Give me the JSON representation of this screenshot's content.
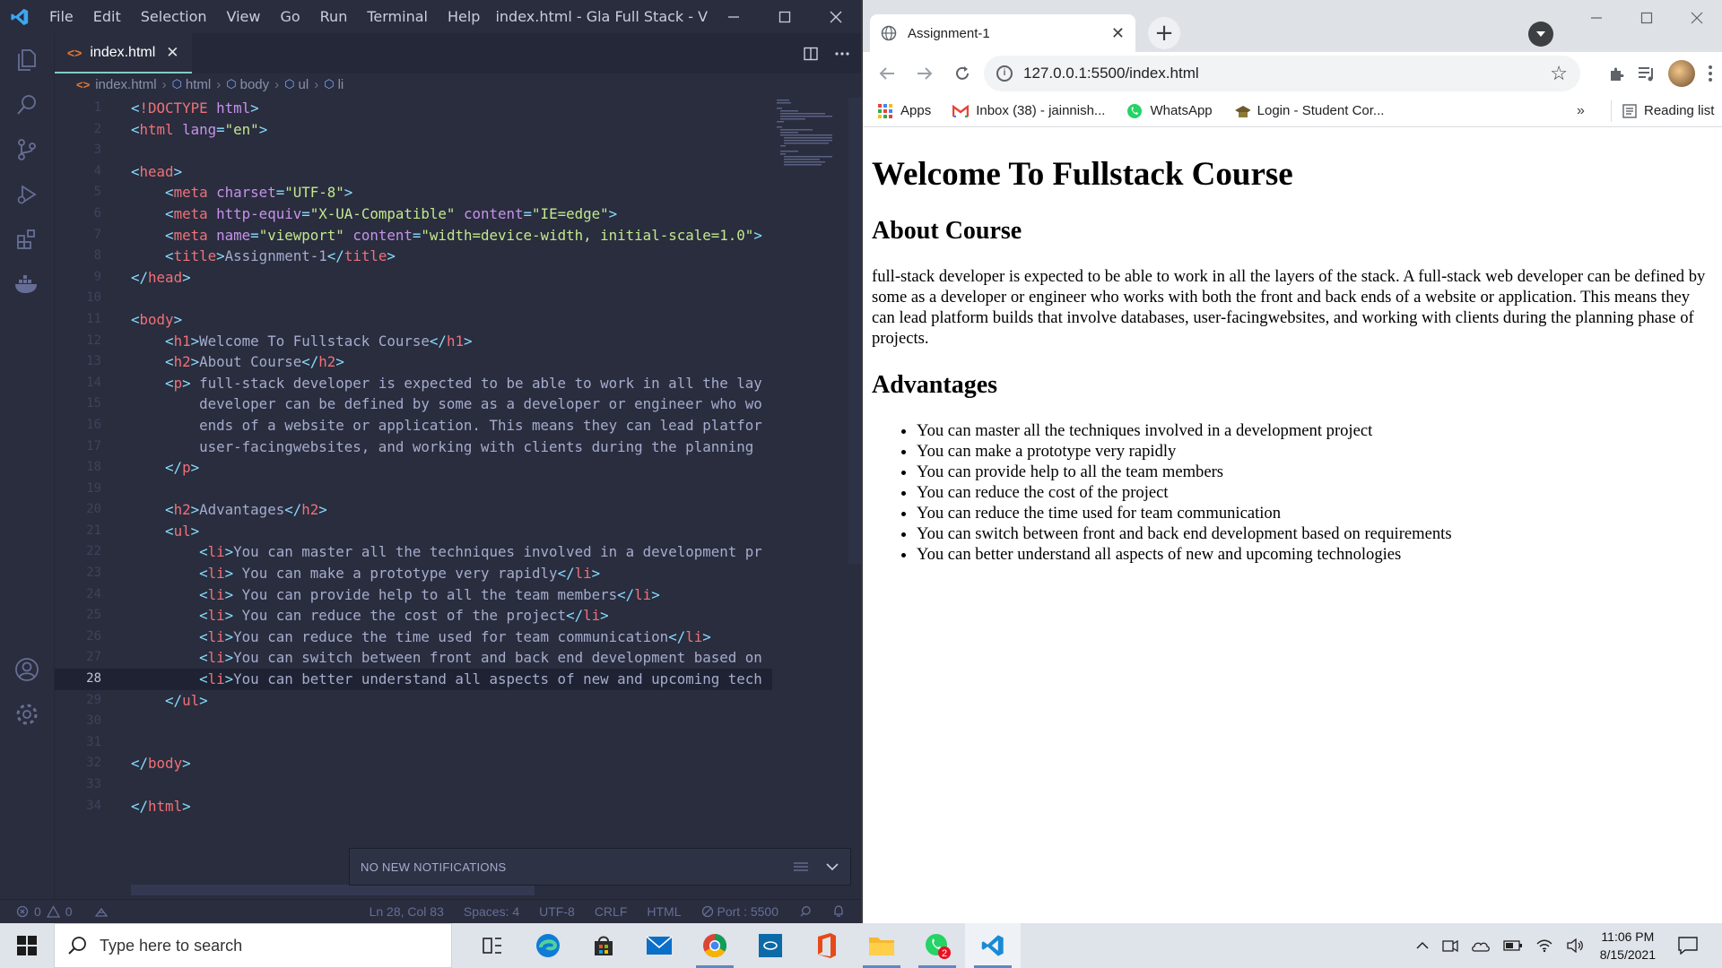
{
  "vscode": {
    "window_title": "index.html - Gla Full Stack - Visual Studio...",
    "menu": [
      "File",
      "Edit",
      "Selection",
      "View",
      "Go",
      "Run",
      "Terminal",
      "Help"
    ],
    "tab": {
      "label": "index.html",
      "close": "✕"
    },
    "breadcrumb": [
      "index.html",
      "html",
      "body",
      "ul",
      "li"
    ],
    "code_lines": [
      "<!DOCTYPE html>",
      "<html lang=\"en\">",
      "",
      "<head>",
      "    <meta charset=\"UTF-8\">",
      "    <meta http-equiv=\"X-UA-Compatible\" content=\"IE=edge\">",
      "    <meta name=\"viewport\" content=\"width=device-width, initial-scale=1.0\">",
      "    <title>Assignment-1</title>",
      "</head>",
      "",
      "<body>",
      "    <h1>Welcome To Fullstack Course</h1>",
      "    <h2>About Course</h2>",
      "    <p> full-stack developer is expected to be able to work in all the lay",
      "        developer can be defined by some as a developer or engineer who wo",
      "        ends of a website or application. This means they can lead platfor",
      "        user-facingwebsites, and working with clients during the planning ",
      "    </p>",
      "",
      "    <h2>Advantages</h2>",
      "    <ul>",
      "        <li>You can master all the techniques involved in a development pr",
      "        <li> You can make a prototype very rapidly</li>",
      "        <li> You can provide help to all the team members</li>",
      "        <li> You can reduce the cost of the project</li>",
      "        <li>You can reduce the time used for team communication</li>",
      "        <li>You can switch between front and back end development based on",
      "        <li>You can better understand all aspects of new and upcoming tech",
      "    </ul>",
      "",
      "",
      "</body>",
      "",
      "</html>"
    ],
    "active_line": 28,
    "notification": "NO NEW NOTIFICATIONS",
    "status": {
      "errors": "0",
      "warnings": "0",
      "position": "Ln 28, Col 83",
      "spaces": "Spaces: 4",
      "encoding": "UTF-8",
      "eol": "CRLF",
      "language": "HTML",
      "port": "Port : 5500"
    },
    "colors": {
      "background": "#292d3e",
      "tag": "#f07178",
      "attr": "#c792ea",
      "string": "#c3e88d",
      "bracket": "#89ddff"
    }
  },
  "chrome": {
    "tab_title": "Assignment-1",
    "url": "127.0.0.1:5500/index.html",
    "bookmarks": [
      "Apps",
      "Inbox (38) - jainnish...",
      "WhatsApp",
      "Login - Student Cor..."
    ],
    "bookmarks_more": "»",
    "reading_list": "Reading list",
    "page": {
      "h1": "Welcome To Fullstack Course",
      "about_heading": "About Course",
      "about_text": "full-stack developer is expected to be able to work in all the layers of the stack. A full-stack web developer can be defined by some as a developer or engineer who works with both the front and back ends of a website or application. This means they can lead platform builds that involve databases, user-facingwebsites, and working with clients during the planning phase of projects.",
      "advantages_heading": "Advantages",
      "advantages": [
        "You can master all the techniques involved in a development project",
        "You can make a prototype very rapidly",
        "You can provide help to all the team members",
        "You can reduce the cost of the project",
        "You can reduce the time used for team communication",
        "You can switch between front and back end development based on requirements",
        "You can better understand all aspects of new and upcoming technologies"
      ]
    }
  },
  "taskbar": {
    "search_placeholder": "Type here to search",
    "time": "11:06 PM",
    "date": "8/15/2021",
    "whatsapp_badge": "2"
  }
}
